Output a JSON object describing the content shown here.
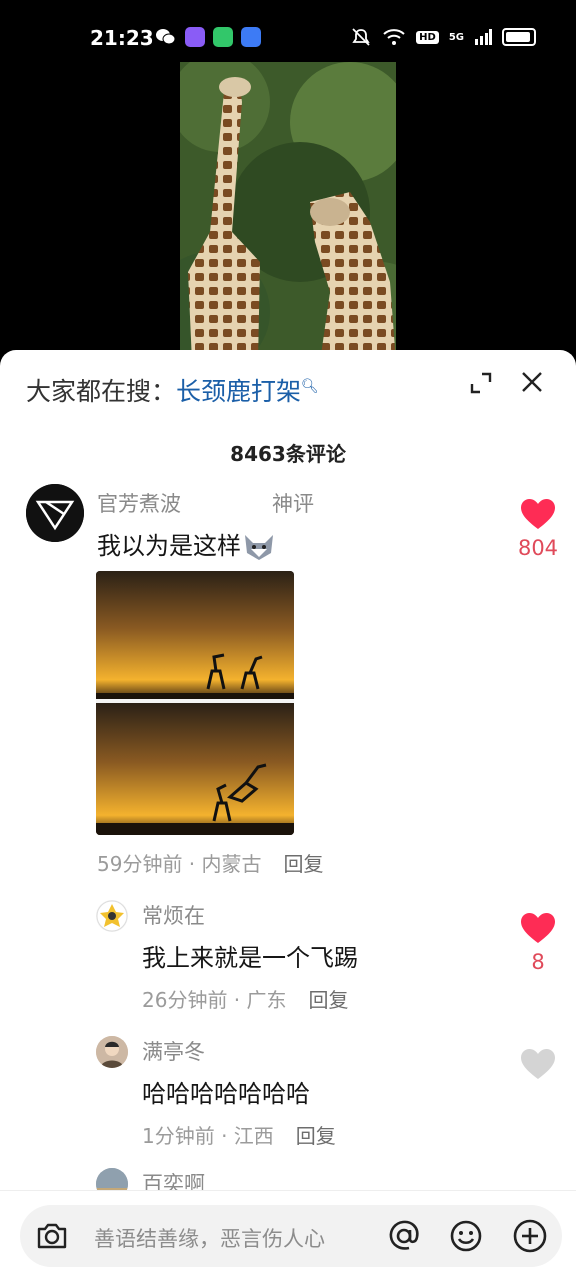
{
  "status_bar": {
    "time": "21:23",
    "network": "5G",
    "hd": "HD"
  },
  "search_suggest": {
    "prefix": "大家都在搜：",
    "term": "长颈鹿打架"
  },
  "comment_count": "8463条评论",
  "comments": [
    {
      "user": "官芳煮波",
      "tag": "神评",
      "text": "我以为是这样",
      "time_location": "59分钟前 · 内蒙古",
      "reply": "回复",
      "likes": "804",
      "liked": true
    }
  ],
  "replies": [
    {
      "user": "常烦在",
      "text": "我上来就是一个飞踢",
      "time_location": "26分钟前 · 广东",
      "reply": "回复",
      "likes": "8",
      "liked": true
    },
    {
      "user": "满亭冬",
      "text": "哈哈哈哈哈哈哈",
      "time_location": "1分钟前 · 江西",
      "reply": "回复",
      "likes": "",
      "liked": false
    },
    {
      "user": "百奕啊",
      "text": "",
      "time_location": "",
      "reply": "",
      "likes": "",
      "liked": false
    }
  ],
  "input": {
    "placeholder": "善语结善缘，恶言伤人心"
  },
  "colors": {
    "like_red": "#fe2c55",
    "link_blue": "#1b5fa8",
    "muted_gray": "#8a8a8a"
  }
}
